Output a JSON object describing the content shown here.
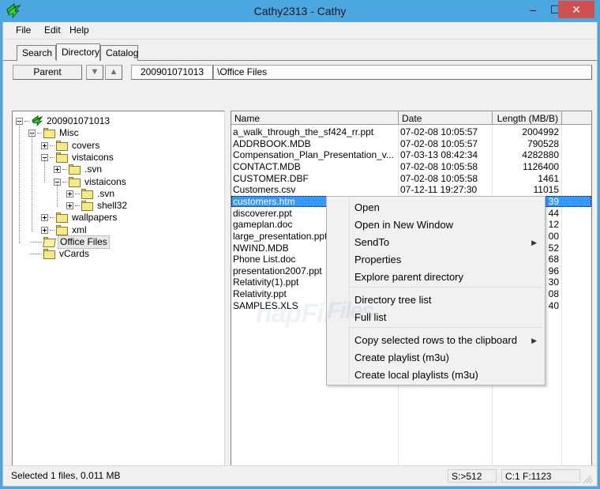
{
  "window": {
    "title": "Cathy2313 - Cathy",
    "app_icon": "green-arrow-icon",
    "minimize_label": "–",
    "maximize_label": "☐",
    "close_label": "✕"
  },
  "menubar": {
    "items": [
      {
        "label": "File"
      },
      {
        "label": "Edit"
      },
      {
        "label": "Help"
      }
    ]
  },
  "tabs": {
    "items": [
      {
        "label": "Search",
        "active": false
      },
      {
        "label": "Directory",
        "active": true
      },
      {
        "label": "Catalog",
        "active": false
      }
    ]
  },
  "toolbar": {
    "parent_label": "Parent",
    "down_icon": "arrow-down-icon",
    "up_icon": "arrow-up-icon",
    "catalog_value": "200901071013",
    "path_value": "\\Office Files"
  },
  "tree": {
    "nodes": [
      {
        "label": "200901071013",
        "depth": 0,
        "toggle": "minus",
        "icon": "disc-icon",
        "selected": false
      },
      {
        "label": "Misc",
        "depth": 1,
        "toggle": "minus",
        "icon": "folder",
        "selected": false
      },
      {
        "label": "covers",
        "depth": 2,
        "toggle": "plus",
        "icon": "folder",
        "selected": false
      },
      {
        "label": "vistaicons",
        "depth": 2,
        "toggle": "minus",
        "icon": "folder",
        "selected": false
      },
      {
        "label": ".svn",
        "depth": 3,
        "toggle": "plus",
        "icon": "folder",
        "selected": false
      },
      {
        "label": "vistaicons",
        "depth": 3,
        "toggle": "minus",
        "icon": "folder",
        "selected": false
      },
      {
        "label": ".svn",
        "depth": 4,
        "toggle": "plus",
        "icon": "folder",
        "selected": false
      },
      {
        "label": "shell32",
        "depth": 4,
        "toggle": "plus",
        "icon": "folder",
        "selected": false
      },
      {
        "label": "wallpapers",
        "depth": 2,
        "toggle": "plus",
        "icon": "folder",
        "selected": false
      },
      {
        "label": "xml",
        "depth": 2,
        "toggle": "plus",
        "icon": "folder",
        "selected": false
      },
      {
        "label": "Office Files",
        "depth": 1,
        "toggle": "none",
        "icon": "folder-open",
        "selected": true
      },
      {
        "label": "vCards",
        "depth": 1,
        "toggle": "none",
        "icon": "folder",
        "selected": false
      }
    ]
  },
  "filelist": {
    "columns": [
      "Name",
      "Date",
      "Length (MB/B)",
      ""
    ],
    "rows": [
      {
        "name": "a_walk_through_the_sf424_rr.ppt",
        "date": "07-02-08 10:05:57",
        "length": "2004992",
        "selected": false
      },
      {
        "name": "ADDRBOOK.MDB",
        "date": "07-02-08 10:05:57",
        "length": "790528",
        "selected": false
      },
      {
        "name": "Compensation_Plan_Presentation_v...",
        "date": "07-03-13 08:42:34",
        "length": "4282880",
        "selected": false
      },
      {
        "name": "CONTACT.MDB",
        "date": "07-02-08 10:05:58",
        "length": "1126400",
        "selected": false
      },
      {
        "name": "CUSTOMER.DBF",
        "date": "07-02-08 10:05:58",
        "length": "1461",
        "selected": false
      },
      {
        "name": "Customers.csv",
        "date": "07-12-11 19:27:30",
        "length": "11015",
        "selected": false
      },
      {
        "name": "customers.htm",
        "date": "",
        "length": "39",
        "selected": true
      },
      {
        "name": "discoverer.ppt",
        "date": "",
        "length": "44",
        "selected": false
      },
      {
        "name": "gameplan.doc",
        "date": "",
        "length": "12",
        "selected": false
      },
      {
        "name": "large_presentation.ppt",
        "date": "",
        "length": "00",
        "selected": false
      },
      {
        "name": "NWIND.MDB",
        "date": "",
        "length": "52",
        "selected": false
      },
      {
        "name": "Phone List.doc",
        "date": "",
        "length": "68",
        "selected": false
      },
      {
        "name": "presentation2007.ppt",
        "date": "",
        "length": "96",
        "selected": false
      },
      {
        "name": "Relativity(1).ppt",
        "date": "",
        "length": "30",
        "selected": false
      },
      {
        "name": "Relativity.ppt",
        "date": "",
        "length": "08",
        "selected": false
      },
      {
        "name": "SAMPLES.XLS",
        "date": "",
        "length": "40",
        "selected": false
      }
    ],
    "scrollbar": {
      "left_icon": "chevron-left-icon",
      "right_icon": "chevron-right-icon"
    }
  },
  "contextmenu": {
    "items": [
      {
        "label": "Open",
        "submenu": false
      },
      {
        "label": "Open in New Window",
        "submenu": false
      },
      {
        "label": "SendTo",
        "submenu": true
      },
      {
        "label": "Properties",
        "submenu": false
      },
      {
        "label": "Explore parent directory",
        "submenu": false
      },
      {
        "label": "Directory tree list",
        "submenu": false
      },
      {
        "label": "Full list",
        "submenu": false
      },
      {
        "label": "Copy selected rows to the clipboard",
        "submenu": true
      },
      {
        "label": "Create playlist (m3u)",
        "submenu": false
      },
      {
        "label": "Create local playlists (m3u)",
        "submenu": false
      }
    ],
    "submenu_arrow": "chevron-right-icon"
  },
  "watermark": {
    "text_left": "Files",
    "text_right": "napFiles"
  },
  "statusbar": {
    "message": "Selected 1 files, 0.011 MB",
    "segment_s": "S:>512",
    "segment_cf": "C:1 F:1123",
    "grip_icon": "resize-grip-icon"
  },
  "colors": {
    "titlebar": "#4ca6e0",
    "close_button": "#d0504f",
    "selection": "#3399ff",
    "chrome": "#f0f0f0"
  }
}
